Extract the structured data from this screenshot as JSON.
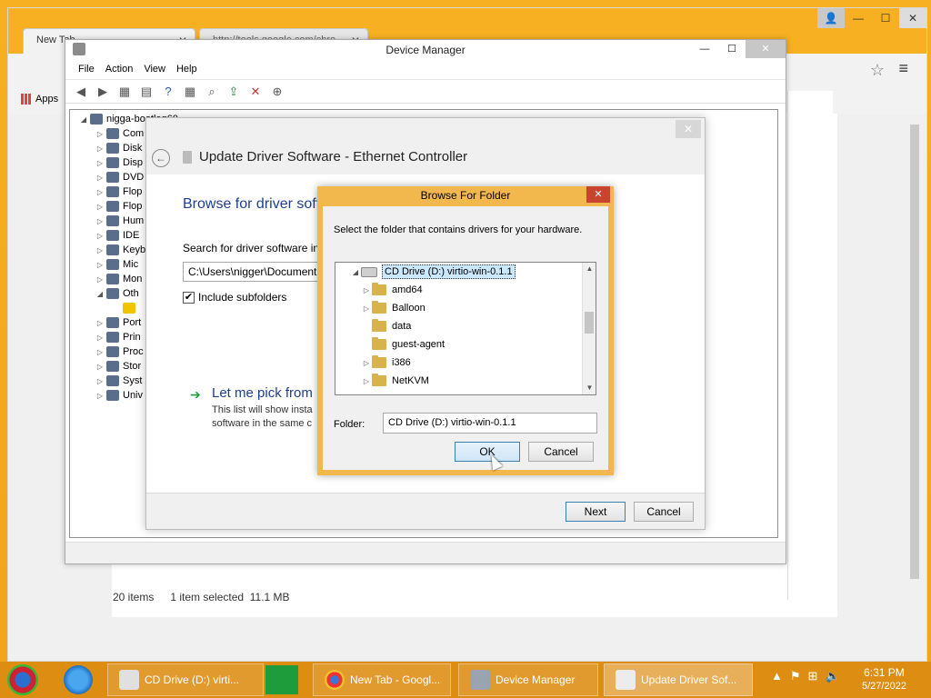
{
  "chrome": {
    "tabs": [
      {
        "label": "New Tab"
      },
      {
        "label": "http://tools.google.com/chro"
      }
    ],
    "bookmarks_apps": "Apps"
  },
  "explorer_status": {
    "items": "20 items",
    "selected": "1 item selected",
    "size": "11.1 MB"
  },
  "device_manager": {
    "title": "Device Manager",
    "menu": [
      "File",
      "Action",
      "View",
      "Help"
    ],
    "tree": [
      {
        "label": "nigga-bootleg60",
        "level": 0,
        "expander": "◢"
      },
      {
        "label": "Com",
        "level": 1,
        "expander": "▷"
      },
      {
        "label": "Disk",
        "level": 1,
        "expander": "▷"
      },
      {
        "label": "Disp",
        "level": 1,
        "expander": "▷"
      },
      {
        "label": "DVD",
        "level": 1,
        "expander": "▷"
      },
      {
        "label": "Flop",
        "level": 1,
        "expander": "▷"
      },
      {
        "label": "Flop",
        "level": 1,
        "expander": "▷"
      },
      {
        "label": "Hum",
        "level": 1,
        "expander": "▷"
      },
      {
        "label": "IDE",
        "level": 1,
        "expander": "▷"
      },
      {
        "label": "Keyb",
        "level": 1,
        "expander": "▷"
      },
      {
        "label": "Mic",
        "level": 1,
        "expander": "▷"
      },
      {
        "label": "Mon",
        "level": 1,
        "expander": "▷"
      },
      {
        "label": "Oth",
        "level": 1,
        "expander": "◢"
      },
      {
        "label": "",
        "level": 2,
        "expander": ""
      },
      {
        "label": "Port",
        "level": 1,
        "expander": "▷"
      },
      {
        "label": "Prin",
        "level": 1,
        "expander": "▷"
      },
      {
        "label": "Proc",
        "level": 1,
        "expander": "▷"
      },
      {
        "label": "Stor",
        "level": 1,
        "expander": "▷"
      },
      {
        "label": "Syst",
        "level": 1,
        "expander": "▷"
      },
      {
        "label": "Univ",
        "level": 1,
        "expander": "▷"
      }
    ]
  },
  "wizard": {
    "title": "Update Driver Software - Ethernet Controller",
    "heading": "Browse for driver soft",
    "search_label": "Search for driver software in",
    "path": "C:\\Users\\nigger\\Document",
    "include_subfolders": "Include subfolders",
    "pick_title": "Let me pick from",
    "pick_desc_1": "This list will show insta",
    "pick_desc_2": "software in the same c",
    "next": "Next",
    "cancel": "Cancel"
  },
  "browse_folder": {
    "title": "Browse For Folder",
    "instruction": "Select the folder that contains drivers for your hardware.",
    "tree": [
      {
        "label": "CD Drive (D:) virtio-win-0.1.1",
        "type": "drive",
        "expander": "◢",
        "selected": true
      },
      {
        "label": "amd64",
        "type": "folder",
        "expander": "▷"
      },
      {
        "label": "Balloon",
        "type": "folder",
        "expander": "▷"
      },
      {
        "label": "data",
        "type": "folder",
        "expander": ""
      },
      {
        "label": "guest-agent",
        "type": "folder",
        "expander": ""
      },
      {
        "label": "i386",
        "type": "folder",
        "expander": "▷"
      },
      {
        "label": "NetKVM",
        "type": "folder",
        "expander": "▷"
      }
    ],
    "folder_label": "Folder:",
    "folder_value": "CD Drive (D:) virtio-win-0.1.1",
    "ok": "OK",
    "cancel": "Cancel"
  },
  "taskbar": {
    "items": [
      {
        "label": "CD Drive (D:) virti...",
        "active": false
      },
      {
        "label": "New Tab - Googl...",
        "active": false
      },
      {
        "label": "Device Manager",
        "active": false
      },
      {
        "label": "Update Driver Sof...",
        "active": true
      }
    ],
    "time": "6:31 PM",
    "date": "5/27/2022"
  },
  "colors": {
    "desktop": "#f6b021",
    "taskbar": "#dd8d12",
    "link_blue": "#1e3f8e",
    "dialog_frame": "#f2b84d"
  }
}
